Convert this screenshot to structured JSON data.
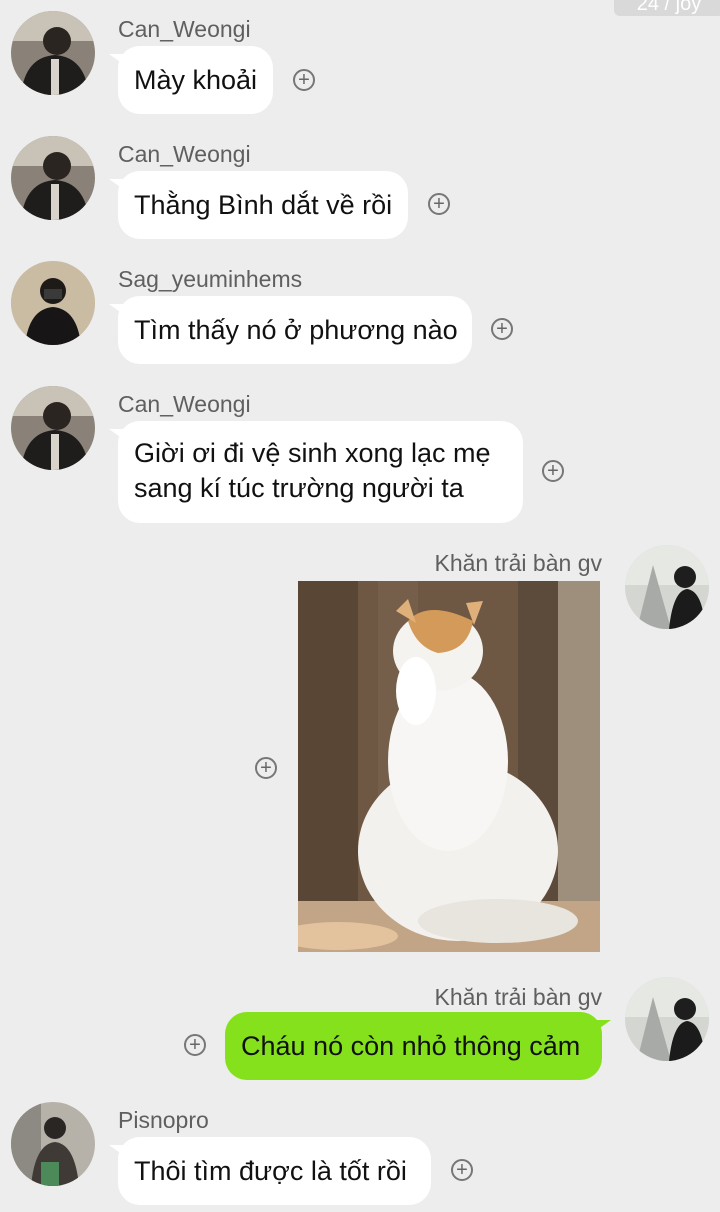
{
  "top_badge": "24 / joy",
  "messages": [
    {
      "sender": "Can_Weongi",
      "text": "Mày khoải"
    },
    {
      "sender": "Can_Weongi",
      "text": "Thằng Bình dắt về rồi"
    },
    {
      "sender": "Sag_yeuminhems",
      "text": "Tìm thấy nó ở phương nào"
    },
    {
      "sender": "Can_Weongi",
      "lines": [
        "Giời ơi đi vệ sinh xong lạc mẹ",
        "sang kí túc trường người ta"
      ]
    },
    {
      "sender": "Khăn trải bàn gv",
      "image": "praying-white-cat-photo"
    },
    {
      "sender": "Khăn trải bàn gv",
      "text": "Cháu nó còn nhỏ thông cảm"
    },
    {
      "sender": "Pisnopro",
      "text": "Thôi tìm được là tốt rồi"
    }
  ],
  "add_reaction_symbol": "+",
  "colors": {
    "background": "#ededed",
    "incoming_bubble": "#ffffff",
    "outgoing_bubble": "#84e11b",
    "sender_name": "#5f5f5f"
  }
}
